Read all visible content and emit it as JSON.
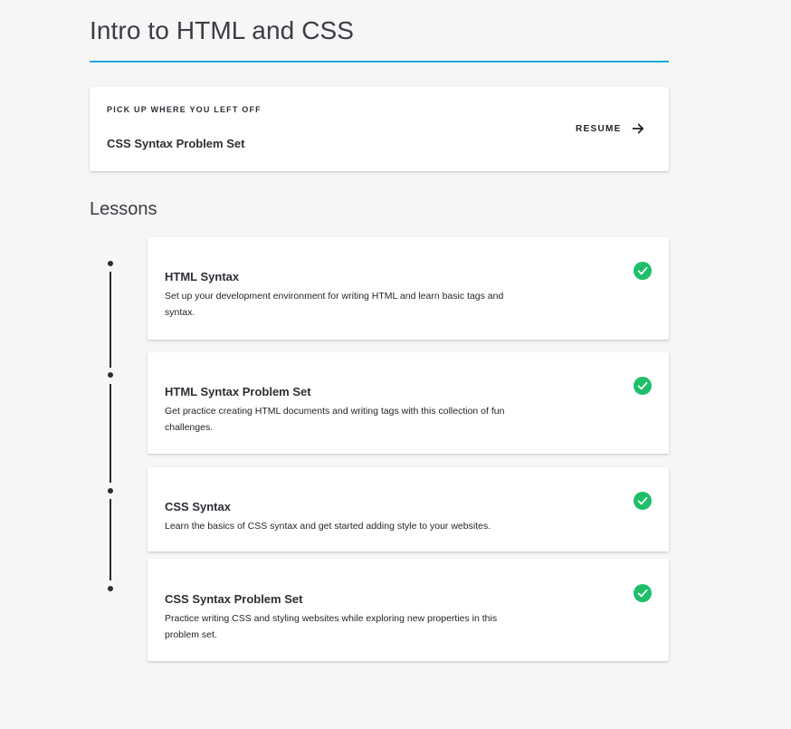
{
  "page": {
    "title": "Intro to HTML and CSS",
    "accent_color": "#18a9dc"
  },
  "resume": {
    "eyebrow": "PICK UP WHERE YOU LEFT OFF",
    "title": "CSS Syntax Problem Set",
    "action_label": "RESUME",
    "action_icon": "arrow-right-icon"
  },
  "lessons": {
    "heading": "Lessons",
    "completed_color": "#1fbf6a",
    "items": [
      {
        "title": "HTML Syntax",
        "description": "Set up your development environment for writing HTML and learn basic tags and syntax.",
        "status": "completed",
        "icon": "check-circle-icon"
      },
      {
        "title": "HTML Syntax Problem Set",
        "description": "Get practice creating HTML documents and writing tags with this collection of fun challenges.",
        "status": "completed",
        "icon": "check-circle-icon"
      },
      {
        "title": "CSS Syntax",
        "description": "Learn the basics of CSS syntax and get started adding style to your websites.",
        "status": "completed",
        "icon": "check-circle-icon"
      },
      {
        "title": "CSS Syntax Problem Set",
        "description": "Practice writing CSS and styling websites while exploring new properties in this problem set.",
        "status": "completed",
        "icon": "check-circle-icon"
      }
    ]
  }
}
